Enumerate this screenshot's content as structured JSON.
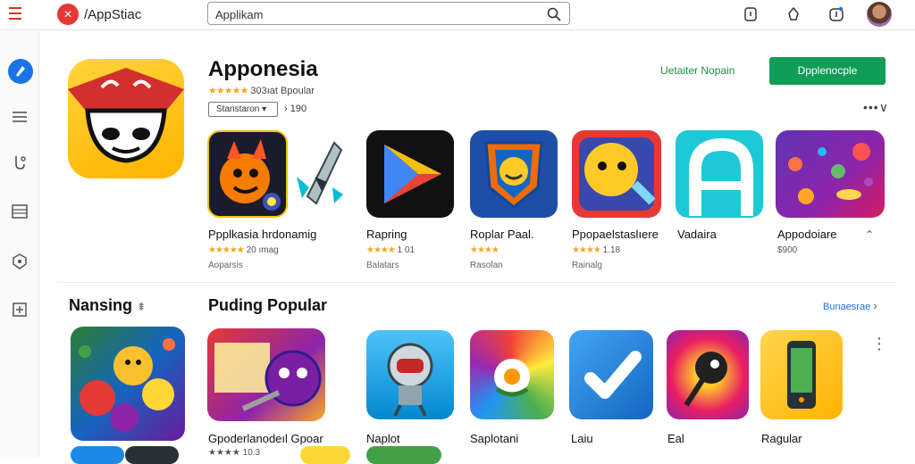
{
  "header": {
    "brand": "/AppStiac",
    "search": {
      "value": "Applikam",
      "placeholder": ""
    }
  },
  "hero": {
    "title": "Apponesia",
    "stars": "★★★★★",
    "rating_text": "303ıat Bpoular",
    "sort_label": "Stanstaron ▾",
    "count": "› 190",
    "link_text": "Uetaiter Nopain",
    "install_label": "Dpplenocple",
    "more": "•••∨"
  },
  "row1": [
    {
      "name": "Ppplkasia hrdonamig",
      "stars": "★★★★★",
      "meta": "20 ımag",
      "sub": "Aoparsis"
    },
    {
      "name": "Rapring",
      "stars": "★★★★",
      "meta": "1 01",
      "sub": "Balatars"
    },
    {
      "name": "Roplar Paal.",
      "stars": "★★★★",
      "meta": "",
      "sub": "Rasolan"
    },
    {
      "name": "Ppopaelstaslıere",
      "stars": "★★★★",
      "meta": "1.18",
      "sub": "Rainalg"
    },
    {
      "name": "Vadaira",
      "stars": "",
      "meta": "",
      "sub": ""
    },
    {
      "name": "Appodoiare",
      "stars": "",
      "meta": "$900",
      "sub": ""
    }
  ],
  "section2": {
    "left_title": "Nansing",
    "left_badge": "⇞",
    "title": "Puding Popular",
    "see_more": "Bunaesrae",
    "tiles": [
      {
        "name": "",
        "stars": ""
      },
      {
        "name": "Gpoderlanodeıl Gpoar",
        "stars": "★★★★ 10.3"
      },
      {
        "name": "Naplot",
        "stars": ""
      },
      {
        "name": "Saplotani",
        "stars": ""
      },
      {
        "name": "Laiu",
        "stars": ""
      },
      {
        "name": "Eal",
        "stars": ""
      },
      {
        "name": "Ragular",
        "stars": ""
      }
    ]
  },
  "colors": {
    "install": "#0f9d58",
    "link": "#1e8e3e",
    "star": "#f5a623",
    "brand": "#e53935"
  }
}
